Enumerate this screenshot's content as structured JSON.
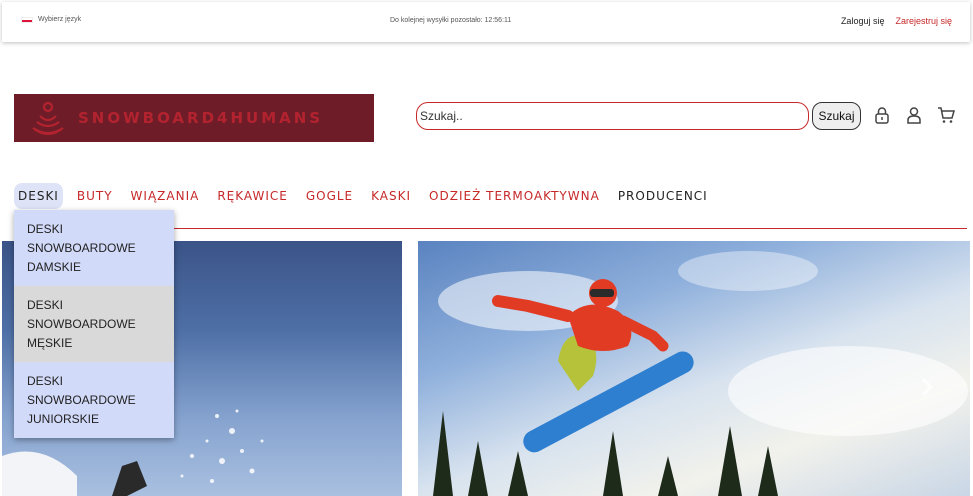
{
  "topbar": {
    "language_label": "Wybierz język",
    "shipping_text": "Do kolejnej wysyłki pozostało: 12:56:11",
    "login_label": "Zaloguj się",
    "register_label": "Zarejestruj się"
  },
  "header": {
    "logo_text": "SNOWBOARD4HUMANS",
    "search_placeholder": "Szukaj..",
    "search_button": "Szukaj",
    "icons": [
      "lock-icon",
      "user-icon",
      "cart-icon"
    ]
  },
  "nav": {
    "items": [
      "DESKI",
      "BUTY",
      "WIĄZANIA",
      "RĘKAWICE",
      "GOGLE",
      "KASKI",
      "ODZIEŻ TERMOAKTYWNA",
      "PRODUCENCI"
    ]
  },
  "dropdown": {
    "items": [
      {
        "line1": "DESKI",
        "line2": "SNOWBOARDOWE",
        "line3": "DAMSKIE"
      },
      {
        "line1": "DESKI",
        "line2": "SNOWBOARDOWE",
        "line3": "MĘSKIE"
      },
      {
        "line1": "DESKI",
        "line2": "SNOWBOARDOWE",
        "line3": "JUNIORSKIE"
      }
    ]
  },
  "colors": {
    "accent": "#c62828",
    "logo_bg": "#6e1d28",
    "dropdown_bg": "#d2daf9",
    "dropdown_hover": "#d9d9d9"
  }
}
